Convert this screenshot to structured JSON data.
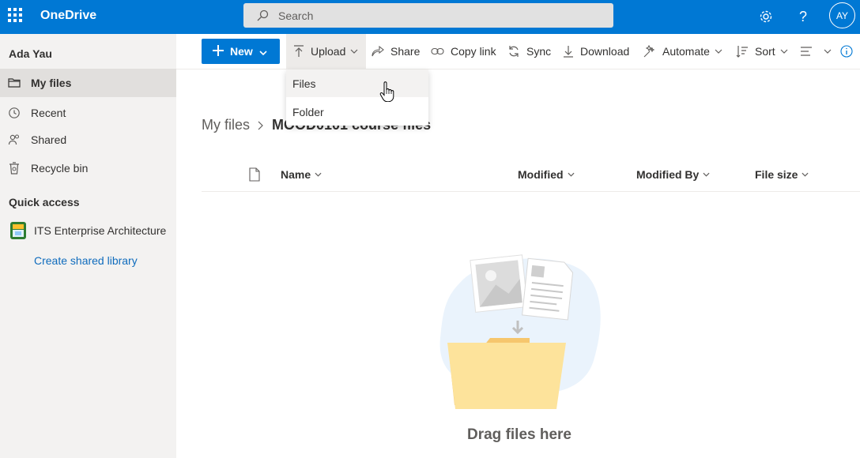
{
  "app": {
    "name": "OneDrive"
  },
  "search": {
    "placeholder": "Search"
  },
  "topbar": {
    "avatar_initials": "AY",
    "settings_icon": "gear-icon",
    "help_icon": "question-icon"
  },
  "sidebar": {
    "user_name": "Ada Yau",
    "items": [
      {
        "label": "My files",
        "icon": "folder-icon",
        "selected": true
      },
      {
        "label": "Recent",
        "icon": "clock-icon",
        "selected": false
      },
      {
        "label": "Shared",
        "icon": "people-icon",
        "selected": false
      },
      {
        "label": "Recycle bin",
        "icon": "trash-icon",
        "selected": false
      }
    ],
    "quick_access_title": "Quick access",
    "quick_access_items": [
      {
        "label": "ITS Enterprise Architecture",
        "icon": "site-logo-icon"
      }
    ],
    "create_shared_library": "Create shared library"
  },
  "commandbar": {
    "new_label": "New",
    "upload_label": "Upload",
    "share_label": "Share",
    "copy_link_label": "Copy link",
    "sync_label": "Sync",
    "download_label": "Download",
    "automate_label": "Automate",
    "sort_label": "Sort"
  },
  "upload_menu": {
    "items": [
      {
        "label": "Files"
      },
      {
        "label": "Folder"
      }
    ]
  },
  "breadcrumb": {
    "root": "My files",
    "current": "MOOD0101 course files"
  },
  "columns": {
    "name": "Name",
    "modified": "Modified",
    "modified_by": "Modified By",
    "file_size": "File size"
  },
  "empty_state": {
    "message": "Drag files here"
  },
  "colors": {
    "brand": "#0078d4",
    "sidebar_bg": "#f3f2f1",
    "link": "#0f6cbd"
  }
}
